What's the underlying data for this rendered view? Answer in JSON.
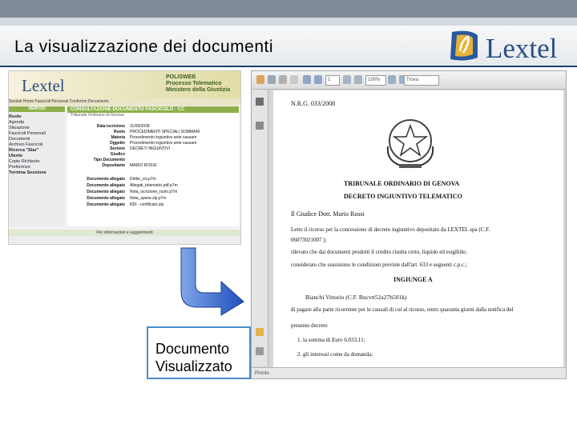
{
  "slide": {
    "title": "La visualizzazione dei documenti",
    "brand": "Lextel"
  },
  "web": {
    "logo": "Lextel",
    "poli": [
      "POLISWEB",
      "Processo Telematico",
      "Ministero della Giustizia"
    ],
    "menu": "Sezioni  Home  Fascicoli Personali  Confermo Documento",
    "sidebar": {
      "header": "SERVIZI",
      "items": [
        "Ruolo",
        "Agenda",
        "Situazione",
        "Fascicoli Personali",
        "Documenti",
        "Archivio Fascicoli",
        "Ricerca \"Star\"",
        "Utente",
        "Copie Richieste",
        "Preferenze",
        "Termina Sessione"
      ]
    },
    "main_header": "CONSULTAZIONE DOCUMENTO FASCICOLO - CC",
    "main_sub": "Tribunale Ordinario di Genova",
    "rows": [
      {
        "label": "Data iscrizione",
        "value": "11/09/2008"
      },
      {
        "label": "Ruolo",
        "value": "PROCEDIMENTI SPECIALI SOMMARI"
      },
      {
        "label": "Materia",
        "value": "Procedimento ingiuntivo ante causam"
      },
      {
        "label": "Oggetto",
        "value": "Procedimento ingiuntivo ante causam"
      },
      {
        "label": "Sezione",
        "value": "DECRETI INGIUNTIVI"
      },
      {
        "label": "Giudice",
        "value": ""
      },
      {
        "label": "Tipo Documento",
        "value": ""
      },
      {
        "label": "Depositante",
        "value": "MARIO ROSSI"
      }
    ],
    "attachments": [
      {
        "label": "Documento allegato",
        "value": "Diritto_civ.p7m"
      },
      {
        "label": "Documento allegato",
        "value": "Allegati_telematici.pdf.p7m"
      },
      {
        "label": "Documento allegato",
        "value": "Nota_iscrizione_ruolo.p7m"
      },
      {
        "label": "Documento allegato",
        "value": "Nota_spese.zip.p7m"
      },
      {
        "label": "Documento allegato",
        "value": "RDI - certificato.zip"
      }
    ],
    "footer": "Per informazioni e suggerimenti"
  },
  "caption": {
    "line1": "Documento",
    "line2": "Visualizzato"
  },
  "pdf": {
    "page_number": "1",
    "zoom": "100%",
    "find_placeholder": "Trova",
    "status": "Pronto",
    "doc": {
      "nrg": "N.R.G. 033/2008",
      "court": "TRIBUNALE ORDINARIO DI GENOVA",
      "decree": "DECRETO INGIUNTIVO TELEMATICO",
      "judge": "Il Giudice Dott. Mario Rossi",
      "line1": "Letto il ricorso per la concessione di decreto ingiuntivo depositato da LEXTEL spa (C.F.",
      "line2": "06073021007 );",
      "line3": "rilevato che dai documenti prodotti il credito risulta certo, liquido ed esigibile;",
      "line4": "considerato che sussistono le condizioni previste dall'art. 633 e seguenti c.p.c.;",
      "enjoin": "INGIUNGE A",
      "debtor": "Bianchi Vittorio (C.F. Bncvtt52a27h501k)",
      "line5": "di pagare alla parte ricorrente per le causali di cui al ricorso, entro quaranta giorni dalla notifica del",
      "line6": "presente decreto",
      "item1": "1.   la somma di Euro 6.033,11;",
      "item2": "2.   gli interessi come da domanda;"
    }
  }
}
